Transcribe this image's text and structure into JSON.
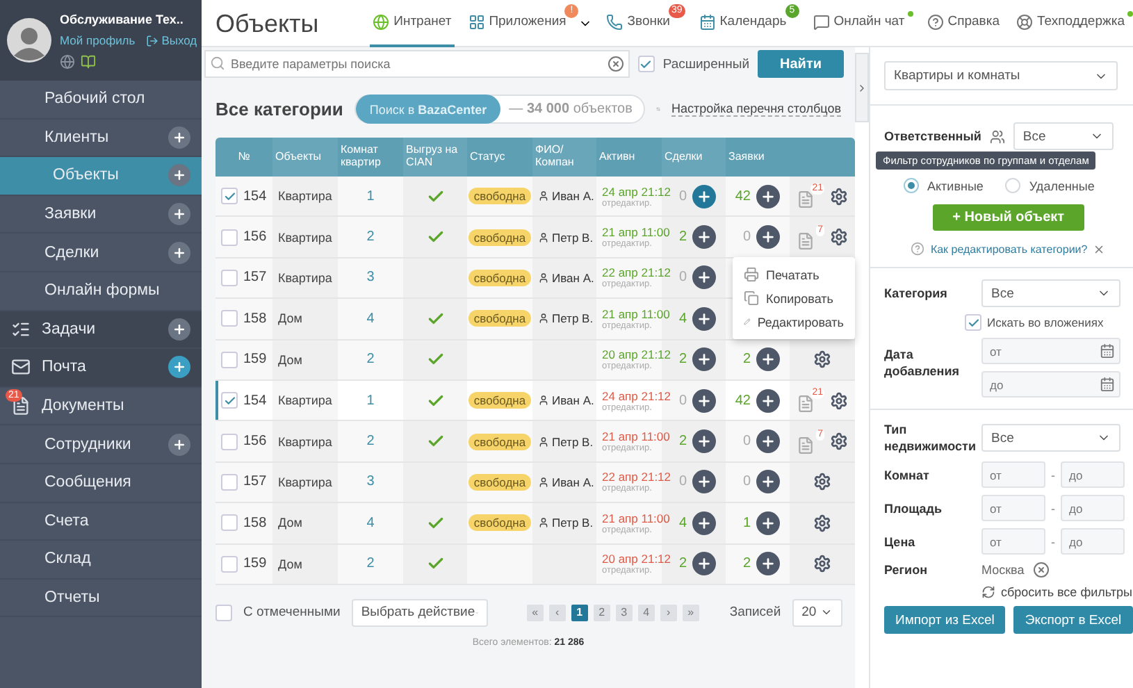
{
  "profile": {
    "name": "Обслуживание Тех..",
    "links": [
      "Мой профиль",
      "Выход"
    ]
  },
  "sidebar": {
    "items": [
      {
        "label": "Рабочий стол",
        "kind": "link",
        "selected": false,
        "add_button": false
      },
      {
        "label": "Клиенты",
        "kind": "link",
        "selected": false,
        "add_button": true
      },
      {
        "label": "Объекты",
        "kind": "link",
        "selected": true,
        "add_button": true
      },
      {
        "label": "Заявки",
        "kind": "link",
        "selected": false,
        "add_button": true
      },
      {
        "label": "Сделки",
        "kind": "link",
        "selected": false,
        "add_button": true
      },
      {
        "label": "Онлайн формы",
        "kind": "link",
        "selected": false,
        "add_button": false
      },
      {
        "label": "Задачи",
        "kind": "tasks",
        "selected": false,
        "add_button": true
      },
      {
        "label": "Почта",
        "kind": "mail",
        "selected": false,
        "add_button": true
      },
      {
        "label": "Документы",
        "kind": "documents",
        "selected": false,
        "add_button": false,
        "badge": "21"
      },
      {
        "label": "Сотрудники",
        "kind": "link",
        "selected": false,
        "add_button": true
      },
      {
        "label": "Сообщения",
        "kind": "link",
        "selected": false,
        "add_button": false
      },
      {
        "label": "Счета",
        "kind": "link",
        "selected": false,
        "add_button": false
      },
      {
        "label": "Склад",
        "kind": "link",
        "selected": false,
        "add_button": false
      },
      {
        "label": "Отчеты",
        "kind": "link",
        "selected": false,
        "add_button": false
      }
    ]
  },
  "page_title": "Объекты",
  "top_nav": [
    {
      "label": "Интранет",
      "kind": "globe",
      "selected": true
    },
    {
      "label": "Приложения",
      "kind": "apps",
      "selected": false,
      "badge": "!",
      "color": "#f08a5d",
      "dropdown": true
    },
    {
      "label": "Звонки",
      "kind": "phone",
      "selected": false,
      "badge": "39",
      "color": "#e8594a"
    },
    {
      "label": "Календарь",
      "kind": "calendar",
      "selected": false,
      "badge": "5",
      "color": "#5aa52c"
    },
    {
      "label": "Онлайн чат",
      "kind": "chat",
      "selected": false,
      "online": true
    },
    {
      "label": "Справка",
      "kind": "help",
      "selected": false
    },
    {
      "label": "Техподдержка",
      "kind": "support",
      "selected": false,
      "online": true
    }
  ],
  "search": {
    "placeholder": "Введите параметры поиска",
    "extended_label": "Расширенный",
    "extended_checked": true,
    "button": "Найти"
  },
  "category_title": "Все категории",
  "bazacenter": {
    "button": "Поиск в **BazaCenter**",
    "count": "— **34 000** объектов"
  },
  "columns_link": "Настройка перечня столбцов",
  "table": {
    "columns": [
      "№",
      "Объекты",
      "Комнат квартир",
      "Выгруз на CIAN",
      "Статус",
      "ФИО/ Компан",
      "Активн",
      "Сделки",
      "Заявки"
    ],
    "rows": [
      {
        "checked": true,
        "highlighted": false,
        "number": "154",
        "type": "Квартира",
        "rooms": "1",
        "cian": true,
        "status": "свободна",
        "person": "Иван А.",
        "date": "24 апр 21:12",
        "edited": "отредактир.",
        "overdue": false,
        "deals": {
          "count": "0",
          "nonzero": false,
          "active": true
        },
        "requests": {
          "count": "42",
          "nonzero": true,
          "active": false
        },
        "actions": [
          {
            "kind": "documents",
            "badge": "21"
          },
          {
            "kind": "settings"
          }
        ]
      },
      {
        "checked": false,
        "highlighted": false,
        "number": "156",
        "type": "Квартира",
        "rooms": "2",
        "cian": true,
        "status": "свободна",
        "person": "Петр В.",
        "date": "21 апр 11:00",
        "edited": "отредактир.",
        "overdue": false,
        "deals": {
          "count": "2",
          "nonzero": true,
          "active": false
        },
        "requests": {
          "count": "0",
          "nonzero": false,
          "active": false
        },
        "actions": [
          {
            "kind": "documents",
            "badge": "7"
          },
          {
            "kind": "settings"
          }
        ]
      },
      {
        "checked": false,
        "highlighted": false,
        "number": "157",
        "type": "Квартира",
        "rooms": "3",
        "cian": false,
        "status": "свободна",
        "person": "Иван А.",
        "date": "22 апр 21:12",
        "edited": "отредактир.",
        "overdue": false,
        "deals": {
          "count": "0",
          "nonzero": false,
          "active": false
        }
      },
      {
        "checked": false,
        "highlighted": false,
        "number": "158",
        "type": "Дом",
        "rooms": "4",
        "cian": true,
        "status": "свободна",
        "person": "Петр В.",
        "date": "21 апр 11:00",
        "edited": "отредактир.",
        "overdue": false,
        "deals": {
          "count": "4",
          "nonzero": true,
          "active": false
        }
      },
      {
        "checked": false,
        "highlighted": false,
        "number": "159",
        "type": "Дом",
        "rooms": "2",
        "cian": true,
        "date": "20 апр 21:12",
        "edited": "отредактир.",
        "overdue": false,
        "deals": {
          "count": "2",
          "nonzero": true,
          "active": false
        },
        "requests": {
          "count": "2",
          "nonzero": true,
          "active": false
        },
        "actions": [
          {
            "kind": "settings"
          }
        ]
      },
      {
        "checked": true,
        "highlighted": true,
        "number": "154",
        "type": "Квартира",
        "rooms": "1",
        "cian": true,
        "status": "свободна",
        "person": "Иван А.",
        "date": "24 апр 21:12",
        "edited": "отредактир.",
        "overdue": true,
        "deals": {
          "count": "0",
          "nonzero": false,
          "active": false
        },
        "requests": {
          "count": "42",
          "nonzero": true,
          "active": false
        },
        "actions": [
          {
            "kind": "documents",
            "badge": "21"
          },
          {
            "kind": "settings"
          }
        ]
      },
      {
        "checked": false,
        "highlighted": false,
        "number": "156",
        "type": "Квартира",
        "rooms": "2",
        "cian": true,
        "status": "свободна",
        "person": "Петр В.",
        "date": "21 апр 11:00",
        "edited": "отредактир.",
        "overdue": true,
        "deals": {
          "count": "2",
          "nonzero": true,
          "active": false
        },
        "requests": {
          "count": "0",
          "nonzero": false,
          "active": false
        },
        "actions": [
          {
            "kind": "documents",
            "badge": "7"
          },
          {
            "kind": "settings"
          }
        ]
      },
      {
        "checked": false,
        "highlighted": false,
        "number": "157",
        "type": "Квартира",
        "rooms": "3",
        "cian": false,
        "status": "свободна",
        "person": "Иван А.",
        "date": "22 апр 21:12",
        "edited": "отредактир.",
        "overdue": true,
        "deals": {
          "count": "0",
          "nonzero": false,
          "active": false
        },
        "requests": {
          "count": "0",
          "nonzero": false,
          "active": false
        },
        "actions": [
          {
            "kind": "settings"
          }
        ]
      },
      {
        "checked": false,
        "highlighted": false,
        "number": "158",
        "type": "Дом",
        "rooms": "4",
        "cian": true,
        "status": "свободна",
        "person": "Петр В.",
        "date": "21 апр 11:00",
        "edited": "отредактир.",
        "overdue": true,
        "deals": {
          "count": "4",
          "nonzero": true,
          "active": false
        },
        "requests": {
          "count": "1",
          "nonzero": true,
          "active": false
        },
        "actions": [
          {
            "kind": "settings"
          }
        ]
      },
      {
        "checked": false,
        "highlighted": false,
        "number": "159",
        "type": "Дом",
        "rooms": "2",
        "cian": true,
        "date": "20 апр 21:12",
        "edited": "отредактир.",
        "overdue": true,
        "deals": {
          "count": "2",
          "nonzero": true,
          "active": false
        },
        "requests": {
          "count": "2",
          "nonzero": true,
          "active": false
        },
        "actions": [
          {
            "kind": "settings"
          }
        ]
      }
    ],
    "context_menu": [
      {
        "kind": "print",
        "label": "Печатать"
      },
      {
        "kind": "copy",
        "label": "Копировать"
      },
      {
        "kind": "edit",
        "label": "Редактировать"
      }
    ]
  },
  "footer": {
    "bulk_label": "С отмеченными",
    "bulk_checked": false,
    "action_select": "Выбрать действие",
    "pages": [
      {
        "label": "«",
        "selected": false
      },
      {
        "label": "‹",
        "selected": false
      },
      {
        "label": "1",
        "selected": true
      },
      {
        "label": "2",
        "selected": false
      },
      {
        "label": "3",
        "selected": false
      },
      {
        "label": "4",
        "selected": false
      },
      {
        "label": "›",
        "selected": false
      },
      {
        "label": "»",
        "selected": false
      }
    ],
    "per_page_label": "Записей",
    "per_page": "20",
    "total_label": "Всего элементов:",
    "total": "21 286"
  },
  "filters": {
    "category_group": "Квартиры и комнаты",
    "responsible_label": "Ответственный",
    "responsible": "Все",
    "tooltip": "Фильтр сотрудников по группам и отделам",
    "radios": [
      {
        "label": "Активные",
        "selected": true
      },
      {
        "label": "Удаленные",
        "selected": false
      }
    ],
    "new_button": "+ Новый объект",
    "help_link": "Как редактировать категории?",
    "category_label": "Категория",
    "category": "Все",
    "nested_label": "Искать во вложениях",
    "nested_checked": true,
    "date_label": "Дата добавления",
    "date_from": {
      "placeholder": "от"
    },
    "date_to": {
      "placeholder": "до"
    },
    "type_label": "Тип недвижимости",
    "type": "Все",
    "ranges": [
      {
        "label": "Комнат",
        "from": {
          "placeholder": "от"
        },
        "separator": "-",
        "to": {
          "placeholder": "до"
        }
      },
      {
        "label": "Площадь",
        "from": {
          "placeholder": "от"
        },
        "separator": "-",
        "to": {
          "placeholder": "до"
        }
      },
      {
        "label": "Цена",
        "from": {
          "placeholder": "от"
        },
        "separator": "-",
        "to": {
          "placeholder": "до"
        }
      }
    ],
    "region_label": "Регион",
    "region": "Москва",
    "reset": "сбросить все фильтры",
    "buttons": [
      "Импорт из Excel",
      "Экспорт в Excel"
    ]
  }
}
